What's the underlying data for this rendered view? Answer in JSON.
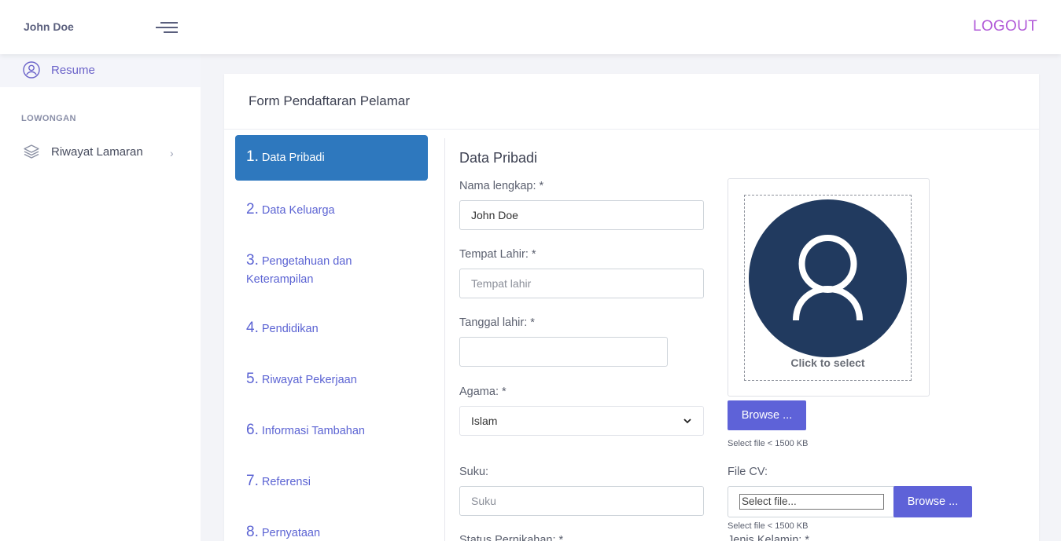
{
  "header": {
    "brand": "John Doe",
    "logout_label": "LOGOUT"
  },
  "sidebar": {
    "resume_label": "Resume",
    "section_label": "LOWONGAN",
    "riwayat_label": "Riwayat Lamaran",
    "chevron": "›"
  },
  "card": {
    "title": "Form Pendaftaran Pelamar"
  },
  "steps": [
    {
      "num": "1.",
      "label": "Data Pribadi"
    },
    {
      "num": "2.",
      "label": "Data Keluarga"
    },
    {
      "num": "3.",
      "label": "Pengetahuan dan",
      "label2": "Keterampilan"
    },
    {
      "num": "4.",
      "label": "Pendidikan"
    },
    {
      "num": "5.",
      "label": "Riwayat Pekerjaan"
    },
    {
      "num": "6.",
      "label": "Informasi Tambahan"
    },
    {
      "num": "7.",
      "label": "Referensi"
    },
    {
      "num": "8.",
      "label": "Pernyataan"
    }
  ],
  "form": {
    "section_title": "Data Pribadi",
    "nama_label": "Nama lengkap: *",
    "nama_value": "John Doe",
    "tempat_label": "Tempat Lahir: *",
    "tempat_placeholder": "Tempat lahir",
    "tanggal_label": "Tanggal lahir: *",
    "agama_label": "Agama: *",
    "agama_value": "Islam",
    "suku_label": "Suku:",
    "suku_placeholder": "Suku",
    "status_label": "Status Pernikahan: *",
    "jenis_label": "Jenis Kelamin: *"
  },
  "photo": {
    "click_label": "Click to select",
    "browse_label": "Browse ...",
    "hint": "Select file < 1500 KB"
  },
  "cv": {
    "label": "File CV:",
    "file_placeholder": "Select file...",
    "browse_label": "Browse ...",
    "hint": "Select file < 1500 KB"
  },
  "colors": {
    "accent": "#5e62d8",
    "active_step": "#2e78be",
    "logout": "#b15ad8",
    "avatar_bg": "#213a5f"
  },
  "icons": {
    "resume": "user-circle-icon",
    "riwayat": "layers-icon",
    "menu": "hamburger-icon",
    "select": "chevron-down-icon"
  }
}
